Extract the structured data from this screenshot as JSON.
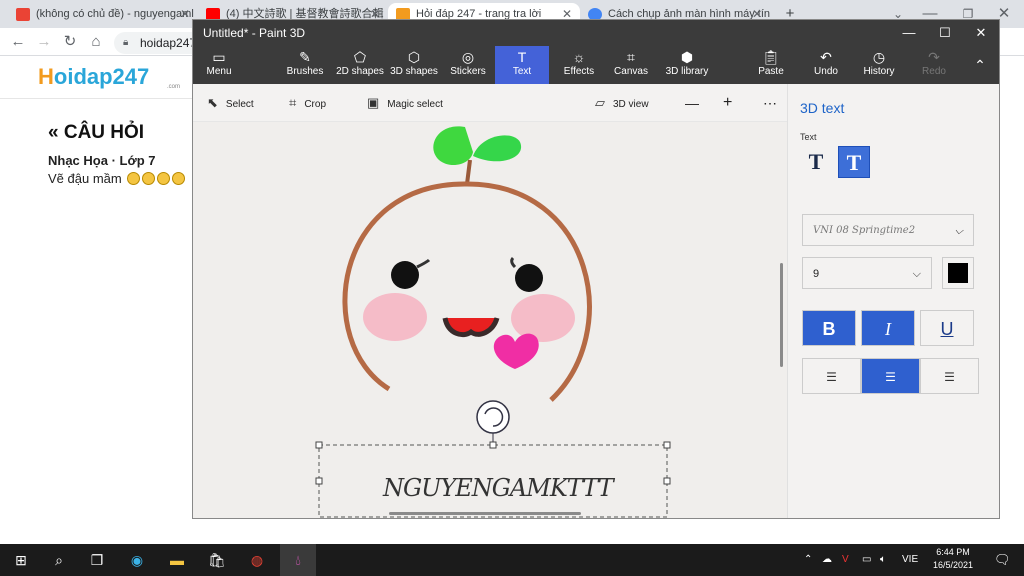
{
  "browser": {
    "tabs": [
      {
        "label": "(không có chủ đề) - nguyengaml",
        "favicon": "gmail-icon",
        "color": "#ea4335"
      },
      {
        "label": "(4) 中文詩歌 | 基督教會詩歌合輯",
        "favicon": "youtube-icon",
        "color": "#ff0000"
      },
      {
        "label": "Hỏi đáp 247 - trang tra lời",
        "favicon": "hoidap-icon",
        "color": "#f29b1f"
      },
      {
        "label": "Cách chụp ảnh màn hình máy tín",
        "favicon": "google-icon",
        "color": "#4285f4"
      }
    ],
    "url": "hoidap247"
  },
  "page": {
    "logo_h": "H",
    "logo_rest": "oidap247",
    "logo_com": ".com",
    "question_title": "« CÂU HỎI",
    "subject": "Nhạc Họa · Lớp 7",
    "question_text": "Vẽ đậu mầm"
  },
  "paint3d": {
    "title": "Untitled* - Paint 3D",
    "ribbon": [
      {
        "label": "Menu",
        "icon": "menu-icon"
      },
      {
        "label": "Brushes",
        "icon": "brush-icon"
      },
      {
        "label": "2D shapes",
        "icon": "2d-shapes-icon"
      },
      {
        "label": "3D shapes",
        "icon": "3d-shapes-icon"
      },
      {
        "label": "Stickers",
        "icon": "stickers-icon"
      },
      {
        "label": "Text",
        "icon": "text-icon"
      },
      {
        "label": "Effects",
        "icon": "effects-icon"
      },
      {
        "label": "Canvas",
        "icon": "canvas-icon"
      },
      {
        "label": "3D library",
        "icon": "3d-library-icon"
      },
      {
        "label": "Paste",
        "icon": "paste-icon"
      },
      {
        "label": "Undo",
        "icon": "undo-icon"
      },
      {
        "label": "History",
        "icon": "history-icon"
      },
      {
        "label": "Redo",
        "icon": "redo-icon"
      }
    ],
    "subbar": {
      "select": "Select",
      "crop": "Crop",
      "magic_select": "Magic select",
      "view_3d": "3D view"
    },
    "canvas_text": "NGUYENGAMKTTT",
    "side": {
      "title": "3D text",
      "text_label": "Text",
      "font": "VNI 08 Springtime2",
      "size": "9",
      "color": "#000000",
      "bold": "B",
      "italic": "I",
      "underline": "U"
    }
  },
  "taskbar": {
    "lang": "VIE",
    "time": "6:44 PM",
    "date": "16/5/2021"
  }
}
